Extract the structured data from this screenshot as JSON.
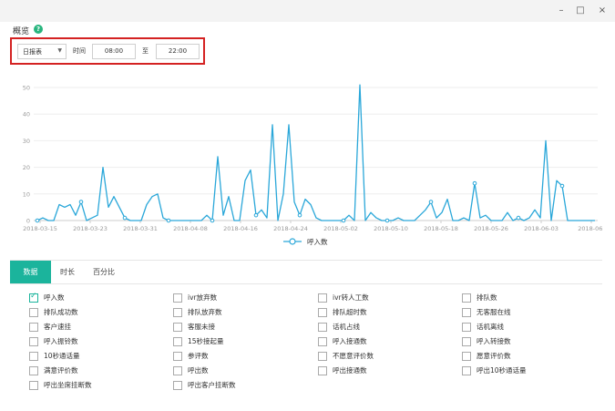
{
  "window": {
    "minimize": "–",
    "maximize": "□",
    "close": "×"
  },
  "header": {
    "title": "概览",
    "help": "?"
  },
  "filter": {
    "report_type": "日报表",
    "time_label": "时间",
    "start_time": "08:00",
    "to_label": "至",
    "end_time": "22:00"
  },
  "chart_data": {
    "type": "line",
    "ylim": [
      0,
      50
    ],
    "yticks": [
      0,
      10,
      20,
      30,
      40,
      50
    ],
    "xtick_labels": [
      "2018-03-15",
      "2018-03-23",
      "2018-03-31",
      "2018-04-08",
      "2018-04-16",
      "2018-04-24",
      "2018-05-02",
      "2018-05-10",
      "2018-05-18",
      "2018-05-26",
      "2018-06-03",
      "2018-06-"
    ],
    "series": [
      {
        "name": "呼入数",
        "color": "#2aa7d9",
        "values": [
          0,
          1,
          0,
          0,
          6,
          5,
          6,
          2,
          7,
          0,
          1,
          2,
          20,
          5,
          9,
          5,
          1,
          0,
          0,
          0,
          6,
          9,
          10,
          1,
          0,
          0,
          0,
          0,
          0,
          0,
          0,
          2,
          0,
          24,
          2,
          9,
          0,
          0,
          15,
          19,
          2,
          4,
          1,
          36,
          0,
          10,
          36,
          7,
          2,
          8,
          6,
          1,
          0,
          0,
          0,
          0,
          0,
          2,
          0,
          51,
          0,
          3,
          1,
          0,
          0,
          0,
          1,
          0,
          0,
          0,
          2,
          4,
          7,
          1,
          3,
          8,
          0,
          0,
          1,
          0,
          14,
          1,
          2,
          0,
          0,
          0,
          3,
          0,
          1,
          0,
          1,
          4,
          1,
          30,
          0,
          15,
          13,
          0,
          0,
          0,
          0,
          0,
          0
        ]
      }
    ],
    "grid": true,
    "legend": "bottom"
  },
  "tabs": [
    {
      "label": "数据",
      "active": true
    },
    {
      "label": "时长",
      "active": false
    },
    {
      "label": "百分比",
      "active": false
    }
  ],
  "metrics": [
    {
      "label": "呼入数",
      "checked": true
    },
    {
      "label": "ivr放弃数",
      "checked": false
    },
    {
      "label": "ivr转人工数",
      "checked": false
    },
    {
      "label": "排队数",
      "checked": false
    },
    {
      "label": "排队成功数",
      "checked": false
    },
    {
      "label": "排队放弃数",
      "checked": false
    },
    {
      "label": "排队超时数",
      "checked": false
    },
    {
      "label": "无客服在线",
      "checked": false
    },
    {
      "label": "客户速挂",
      "checked": false
    },
    {
      "label": "客服未接",
      "checked": false
    },
    {
      "label": "话机占线",
      "checked": false
    },
    {
      "label": "话机离线",
      "checked": false
    },
    {
      "label": "呼入振铃数",
      "checked": false
    },
    {
      "label": "15秒接起量",
      "checked": false
    },
    {
      "label": "呼入接通数",
      "checked": false
    },
    {
      "label": "呼入转接数",
      "checked": false
    },
    {
      "label": "10秒通话量",
      "checked": false
    },
    {
      "label": "参评数",
      "checked": false
    },
    {
      "label": "不愿意评价数",
      "checked": false
    },
    {
      "label": "愿意评价数",
      "checked": false
    },
    {
      "label": "满意评价数",
      "checked": false
    },
    {
      "label": "呼出数",
      "checked": false
    },
    {
      "label": "呼出接通数",
      "checked": false
    },
    {
      "label": "呼出10秒通话量",
      "checked": false
    },
    {
      "label": "呼出坐席挂断数",
      "checked": false
    },
    {
      "label": "呼出客户挂断数",
      "checked": false
    }
  ]
}
